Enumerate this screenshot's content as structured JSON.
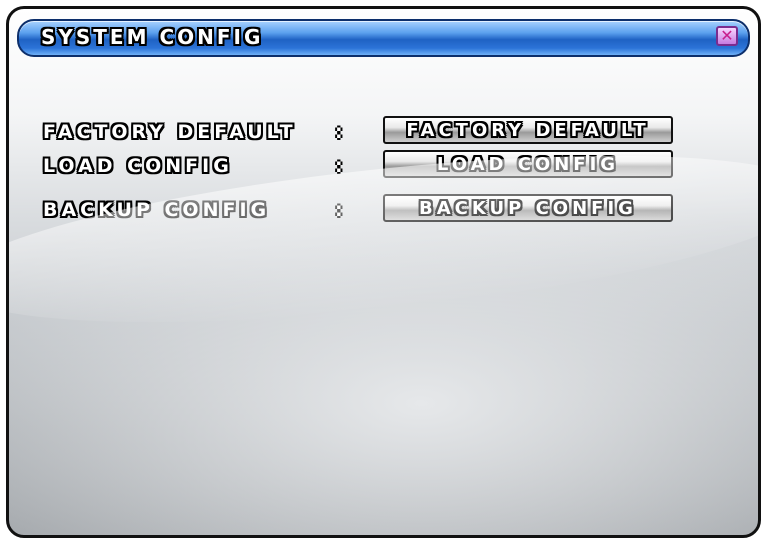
{
  "window": {
    "title": "SYSTEM CONFIG",
    "close_icon": "close-icon",
    "title_bar_color": "#2c74d8"
  },
  "rows": [
    {
      "label": "FACTORY DEFAULT",
      "separator": ":",
      "button_label": "FACTORY DEFAULT"
    },
    {
      "label": "LOAD CONFIG",
      "separator": ":",
      "button_label": "LOAD CONFIG"
    },
    {
      "label": "BACKUP CONFIG",
      "separator": ":",
      "button_label": "BACKUP CONFIG"
    }
  ]
}
